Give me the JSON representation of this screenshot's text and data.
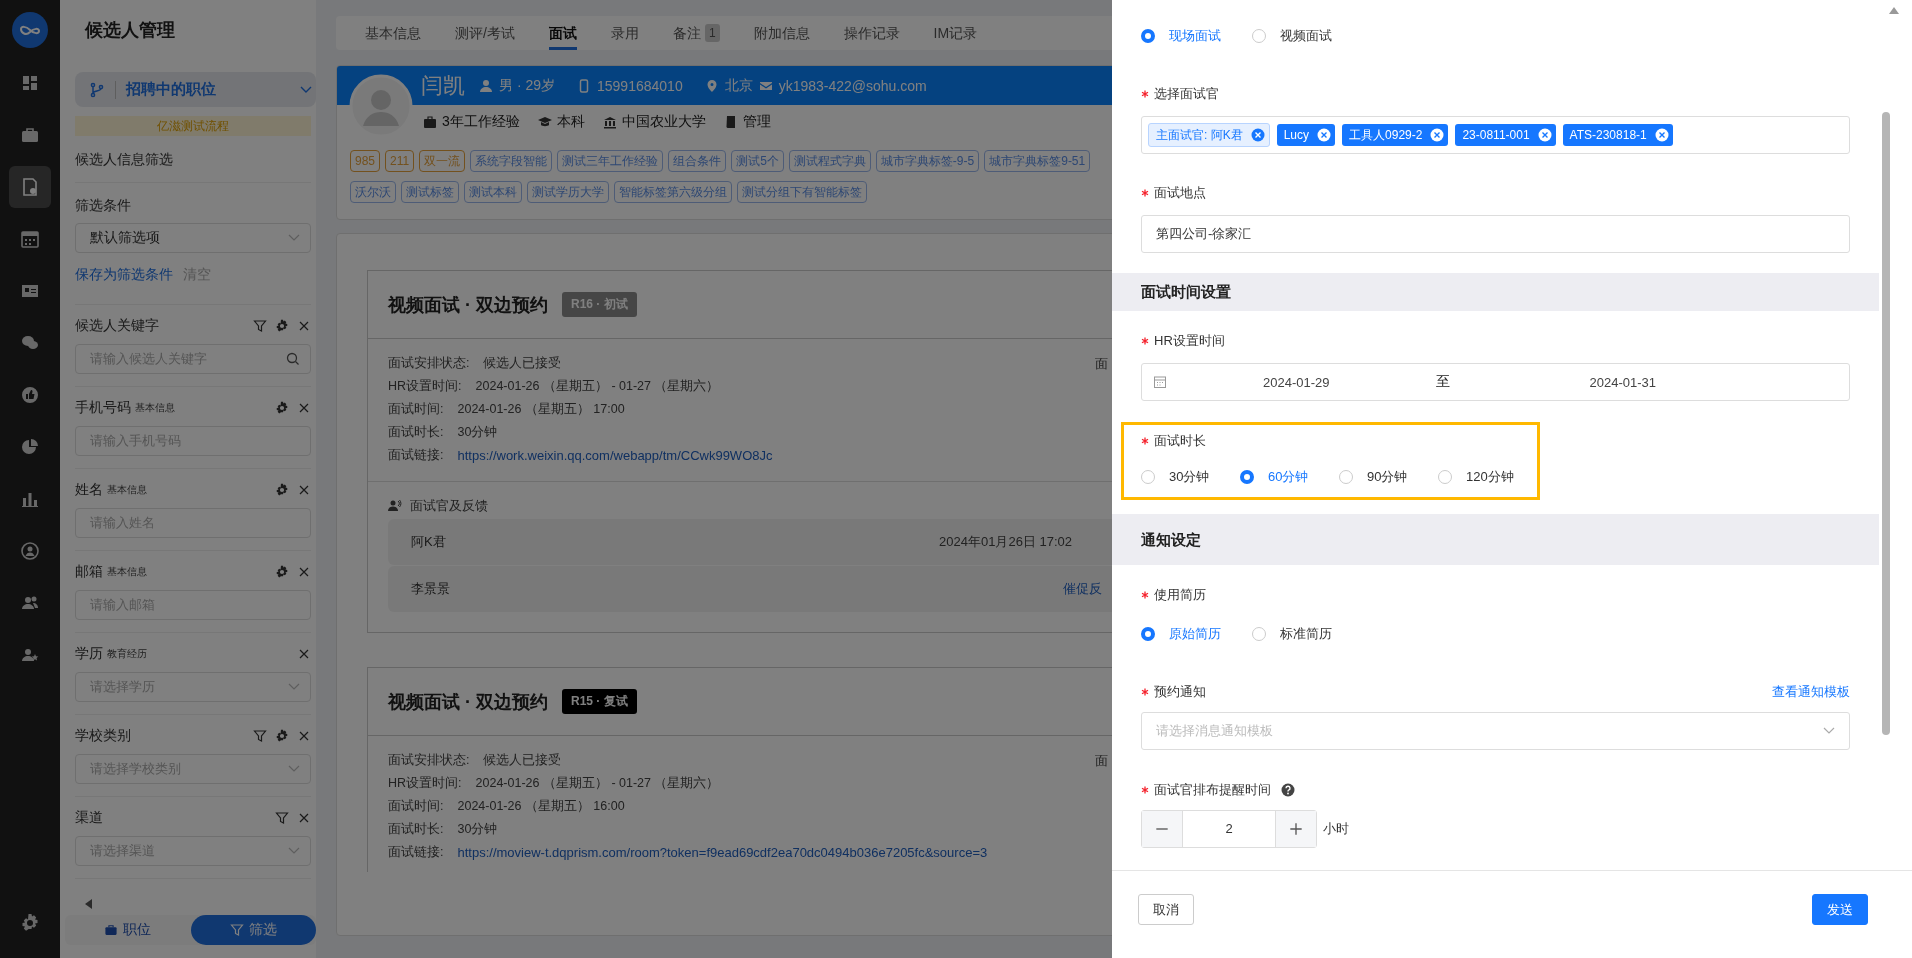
{
  "rail": {
    "items": [
      {
        "selected": false
      },
      {
        "selected": false
      },
      {
        "selected": true
      },
      {
        "selected": false
      },
      {
        "selected": false
      },
      {
        "selected": false
      },
      {
        "selected": false
      },
      {
        "selected": false
      },
      {
        "selected": false
      },
      {
        "selected": false
      },
      {
        "selected": false
      },
      {
        "selected": false
      }
    ]
  },
  "left_panel": {
    "title": "候选人管理",
    "position_select": "招聘中的职位",
    "process_banner": "亿滋测试流程",
    "section_title": "候选人信息筛选",
    "condition_label": "筛选条件",
    "condition_select": "默认筛选项",
    "save_link": "保存为筛选条件",
    "clear_link": "清空",
    "filters": [
      {
        "label": "候选人关键字",
        "kind": "search",
        "placeholder": "请输入候选人关键字",
        "filterable": true,
        "configurable": true
      },
      {
        "label": "手机号码",
        "sublabel": "基本信息",
        "kind": "input",
        "placeholder": "请输入手机号码",
        "filterable": false,
        "configurable": true
      },
      {
        "label": "姓名",
        "sublabel": "基本信息",
        "kind": "input",
        "placeholder": "请输入姓名",
        "filterable": false,
        "configurable": true
      },
      {
        "label": "邮箱",
        "sublabel": "基本信息",
        "kind": "input",
        "placeholder": "请输入邮箱",
        "filterable": false,
        "configurable": true
      },
      {
        "label": "学历",
        "sublabel": "教育经历",
        "kind": "select",
        "placeholder": "请选择学历",
        "filterable": false,
        "configurable": false
      },
      {
        "label": "学校类别",
        "kind": "select",
        "placeholder": "请选择学校类别",
        "filterable": true,
        "configurable": true
      },
      {
        "label": "渠道",
        "kind": "select",
        "placeholder": "请选择渠道",
        "filterable": true,
        "configurable": false
      }
    ],
    "bottom_tabs": [
      {
        "label": "职位",
        "selected": false
      },
      {
        "label": "筛选",
        "selected": true
      }
    ]
  },
  "tabs": [
    {
      "label": "基本信息",
      "selected": false
    },
    {
      "label": "测评/考试",
      "selected": false
    },
    {
      "label": "面试",
      "selected": true
    },
    {
      "label": "录用",
      "selected": false
    },
    {
      "label": "备注",
      "selected": false,
      "badge": "1"
    },
    {
      "label": "附加信息",
      "selected": false
    },
    {
      "label": "操作记录",
      "selected": false
    },
    {
      "label": "IM记录",
      "selected": false
    }
  ],
  "candidate": {
    "name": "闫凯",
    "gender_age": "男 · 29岁",
    "phone": "15991684010",
    "city": "北京",
    "email": "yk1983-422@sohu.com",
    "facts": [
      "3年工作经验",
      "本科",
      "中国农业大学",
      "管理"
    ],
    "tags": [
      {
        "label": "985",
        "kind": "school"
      },
      {
        "label": "211",
        "kind": "school"
      },
      {
        "label": "双一流",
        "kind": "school"
      },
      {
        "label": "系统字段智能",
        "kind": "custom"
      },
      {
        "label": "测试三年工作经验",
        "kind": "custom"
      },
      {
        "label": "组合条件",
        "kind": "custom"
      },
      {
        "label": "测试5个",
        "kind": "custom"
      },
      {
        "label": "测试程式字典",
        "kind": "custom"
      },
      {
        "label": "城市字典标签-9-5",
        "kind": "custom"
      },
      {
        "label": "城市字典标签9-51",
        "kind": "custom"
      },
      {
        "label": "沃尔沃",
        "kind": "custom"
      },
      {
        "label": "测试标签",
        "kind": "custom"
      },
      {
        "label": "测试本科",
        "kind": "custom"
      },
      {
        "label": "测试学历大学",
        "kind": "custom"
      },
      {
        "label": "智能标签第六级分组",
        "kind": "custom"
      },
      {
        "label": "测试分组下有智能标签",
        "kind": "custom"
      }
    ]
  },
  "interviews": [
    {
      "title": "视频面试 · 双边预约",
      "badge": {
        "text": "R16 · 初试",
        "kind": "muted"
      },
      "side_label": "面",
      "details": [
        {
          "label": "面试安排状态:",
          "value": "候选人已接受",
          "kind": "text"
        },
        {
          "label": "HR设置时间:",
          "value": "2024-01-26 （星期五） - 01-27 （星期六）",
          "kind": "text"
        },
        {
          "label": "面试时间:",
          "value": "2024-01-26 （星期五） 17:00",
          "kind": "text"
        },
        {
          "label": "面试时长:",
          "value": "30分钟",
          "kind": "text"
        },
        {
          "label": "面试链接:",
          "value": "https://work.weixin.qq.com/webapp/tm/CCwk99WO8Jc",
          "kind": "link"
        }
      ],
      "feedback": {
        "title": "面试官及反馈",
        "rows": [
          {
            "name": "阿K君",
            "time": "2024年01月26日 17:02"
          },
          {
            "name": "李景景",
            "action": "催促反"
          }
        ]
      }
    },
    {
      "title": "视频面试 · 双边预约",
      "badge": {
        "text": "R15 · 复试",
        "kind": "dark"
      },
      "side_label": "面",
      "details": [
        {
          "label": "面试安排状态:",
          "value": "候选人已接受",
          "kind": "text"
        },
        {
          "label": "HR设置时间:",
          "value": "2024-01-26 （星期五） - 01-27 （星期六）",
          "kind": "text"
        },
        {
          "label": "面试时间:",
          "value": "2024-01-26 （星期五） 16:00",
          "kind": "text"
        },
        {
          "label": "面试时长:",
          "value": "30分钟",
          "kind": "text"
        },
        {
          "label": "面试链接:",
          "value": "https://moview-t.dqprism.com/room?token=f9ead69cdf2ea70dc0494b036e7205fc&source=3",
          "kind": "link"
        }
      ]
    }
  ],
  "drawer": {
    "interview_type": [
      {
        "label": "现场面试",
        "selected": true
      },
      {
        "label": "视频面试",
        "selected": false
      }
    ],
    "interviewers": {
      "label": "选择面试官",
      "required": true,
      "tags": [
        {
          "label": "主面试官: 阿K君",
          "kind": "primary"
        },
        {
          "label": "Lucy",
          "kind": "normal"
        },
        {
          "label": "工具人0929-2",
          "kind": "normal"
        },
        {
          "label": "23-0811-001",
          "kind": "normal"
        },
        {
          "label": "ATS-230818-1",
          "kind": "normal"
        }
      ]
    },
    "location": {
      "label": "面试地点",
      "required": true,
      "value": "第四公司-徐家汇"
    },
    "time_section": "面试时间设置",
    "hr_time": {
      "label": "HR设置时间",
      "required": true,
      "start": "2024-01-29",
      "separator": "至",
      "end": "2024-01-31"
    },
    "duration": {
      "label": "面试时长",
      "required": true,
      "highlighted": true,
      "options": [
        {
          "label": "30分钟",
          "selected": false
        },
        {
          "label": "60分钟",
          "selected": true
        },
        {
          "label": "90分钟",
          "selected": false
        },
        {
          "label": "120分钟",
          "selected": false
        }
      ]
    },
    "notice_section": "通知设定",
    "resume": {
      "label": "使用简历",
      "required": true,
      "options": [
        {
          "label": "原始简历",
          "selected": true
        },
        {
          "label": "标准简历",
          "selected": false
        }
      ]
    },
    "notice": {
      "label": "预约通知",
      "required": true,
      "link": "查看通知模板",
      "placeholder": "请选择消息通知模板"
    },
    "reminder": {
      "label": "面试官排布提醒时间",
      "required": true,
      "value": "2",
      "unit": "小时"
    },
    "buttons": [
      {
        "label": "取消",
        "kind": "default"
      },
      {
        "label": "发送",
        "kind": "primary"
      }
    ]
  }
}
